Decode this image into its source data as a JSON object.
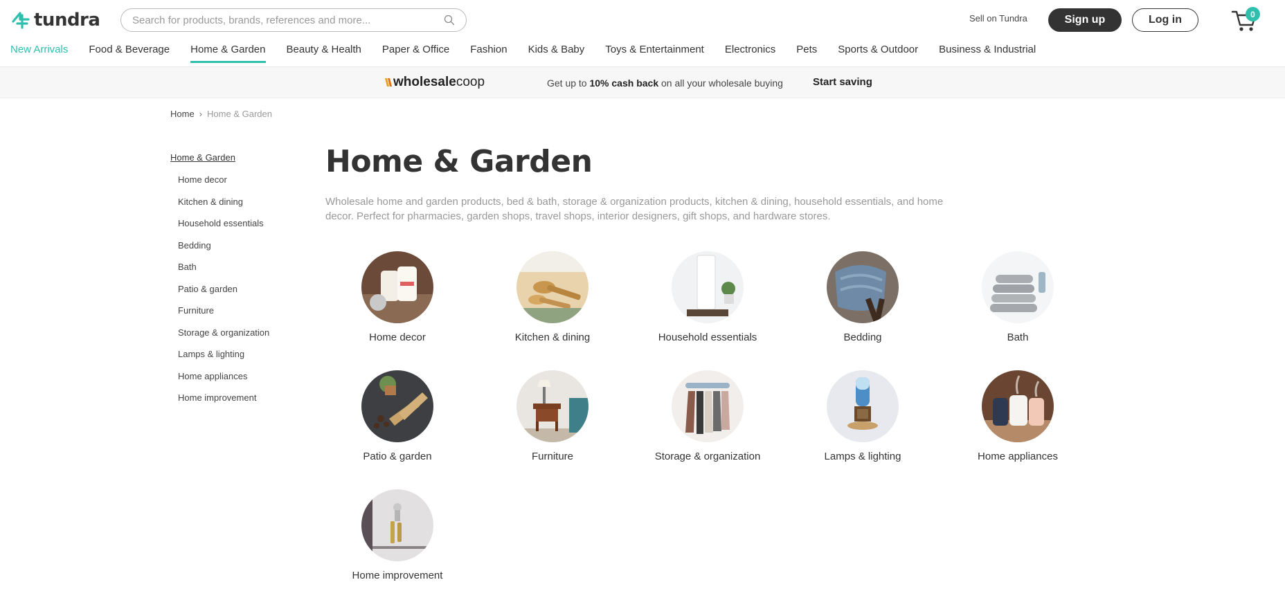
{
  "brand": {
    "name": "tundra",
    "accent": "#2fbfad"
  },
  "search": {
    "placeholder": "Search for products, brands, references and more..."
  },
  "header": {
    "sell_label": "Sell on Tundra",
    "signup_label": "Sign up",
    "login_label": "Log in",
    "cart_count": "0"
  },
  "nav": [
    {
      "label": "New Arrivals"
    },
    {
      "label": "Food & Beverage"
    },
    {
      "label": "Home & Garden"
    },
    {
      "label": "Beauty & Health"
    },
    {
      "label": "Paper & Office"
    },
    {
      "label": "Fashion"
    },
    {
      "label": "Kids & Baby"
    },
    {
      "label": "Toys & Entertainment"
    },
    {
      "label": "Electronics"
    },
    {
      "label": "Pets"
    },
    {
      "label": "Sports & Outdoor"
    },
    {
      "label": "Business & Industrial"
    }
  ],
  "promo": {
    "logo_bold": "wholesale",
    "logo_light": "coop",
    "text_before": "Get up to ",
    "text_bold": "10% cash back",
    "text_after": " on all your wholesale buying",
    "cta": "Start saving"
  },
  "breadcrumb": {
    "home": "Home",
    "separator": "›",
    "current": "Home & Garden"
  },
  "sidebar": {
    "parent": "Home & Garden",
    "items": [
      "Home decor",
      "Kitchen & dining",
      "Household essentials",
      "Bedding",
      "Bath",
      "Patio & garden",
      "Furniture",
      "Storage & organization",
      "Lamps & lighting",
      "Home appliances",
      "Home improvement"
    ]
  },
  "main": {
    "title": "Home & Garden",
    "description": "Wholesale home and garden products, bed & bath, storage & organization products, kitchen & dining, household essentials, and home decor. Perfect for pharmacies, garden shops, travel shops, interior designers, gift shops, and hardware stores."
  },
  "categories": [
    "Home decor",
    "Kitchen & dining",
    "Household essentials",
    "Bedding",
    "Bath",
    "Patio & garden",
    "Furniture",
    "Storage & organization",
    "Lamps & lighting",
    "Home appliances",
    "Home improvement"
  ]
}
